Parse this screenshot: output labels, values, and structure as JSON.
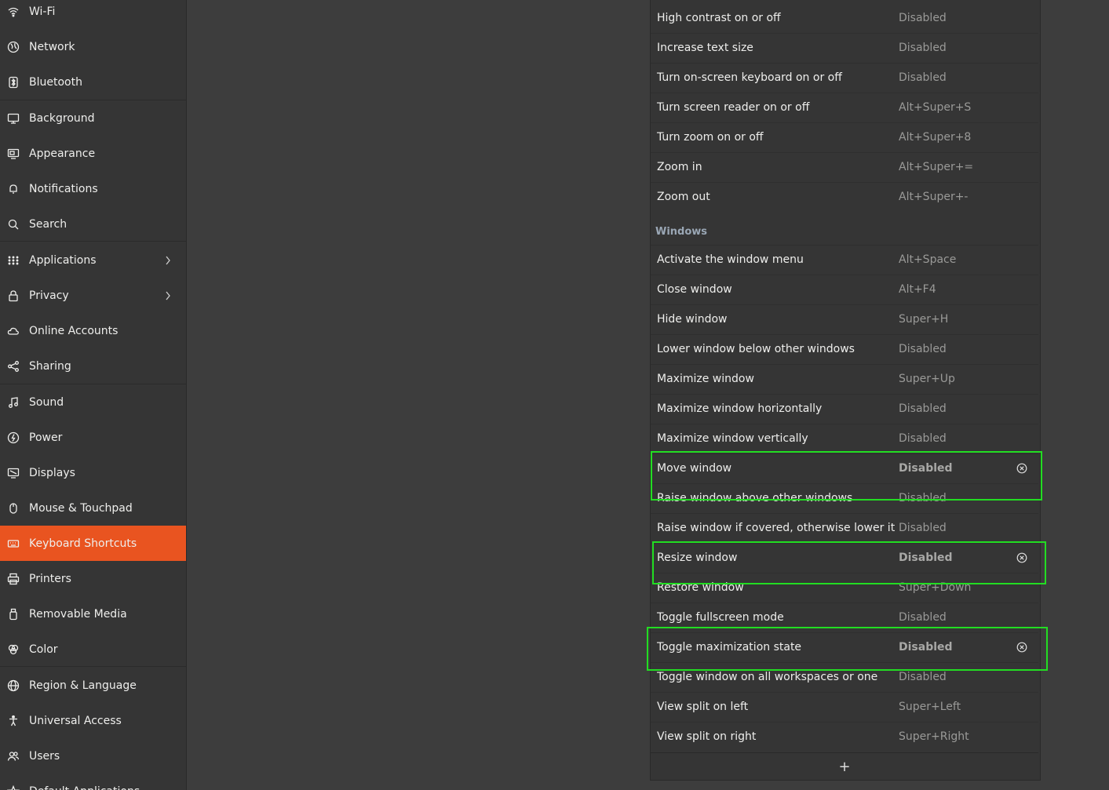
{
  "sidebar": {
    "items": [
      {
        "label": "Wi-Fi",
        "icon": "wifi-icon"
      },
      {
        "label": "Network",
        "icon": "network-icon"
      },
      {
        "label": "Bluetooth",
        "icon": "bluetooth-icon"
      },
      {
        "label": "Background",
        "icon": "background-icon"
      },
      {
        "label": "Appearance",
        "icon": "appearance-icon"
      },
      {
        "label": "Notifications",
        "icon": "bell-icon"
      },
      {
        "label": "Search",
        "icon": "search-icon"
      },
      {
        "label": "Applications",
        "icon": "apps-grid-icon",
        "chevron": true
      },
      {
        "label": "Privacy",
        "icon": "lock-icon",
        "chevron": true
      },
      {
        "label": "Online Accounts",
        "icon": "cloud-icon"
      },
      {
        "label": "Sharing",
        "icon": "share-icon"
      },
      {
        "label": "Sound",
        "icon": "music-note-icon"
      },
      {
        "label": "Power",
        "icon": "power-icon"
      },
      {
        "label": "Displays",
        "icon": "display-icon"
      },
      {
        "label": "Mouse & Touchpad",
        "icon": "mouse-icon"
      },
      {
        "label": "Keyboard Shortcuts",
        "icon": "keyboard-icon",
        "active": true
      },
      {
        "label": "Printers",
        "icon": "printer-icon"
      },
      {
        "label": "Removable Media",
        "icon": "usb-drive-icon"
      },
      {
        "label": "Color",
        "icon": "color-icon"
      },
      {
        "label": "Region & Language",
        "icon": "globe-icon"
      },
      {
        "label": "Universal Access",
        "icon": "accessibility-icon"
      },
      {
        "label": "Users",
        "icon": "users-icon"
      },
      {
        "label": "Default Applications",
        "icon": "star-icon"
      }
    ]
  },
  "accent_color": "#e95420",
  "highlight_color": "#22dd22",
  "shortcuts": {
    "top_rows": [
      {
        "name": "High contrast on or off",
        "accel": "Disabled"
      },
      {
        "name": "Increase text size",
        "accel": "Disabled"
      },
      {
        "name": "Turn on-screen keyboard on or off",
        "accel": "Disabled"
      },
      {
        "name": "Turn screen reader on or off",
        "accel": "Alt+Super+S"
      },
      {
        "name": "Turn zoom on or off",
        "accel": "Alt+Super+8"
      },
      {
        "name": "Zoom in",
        "accel": "Alt+Super+="
      },
      {
        "name": "Zoom out",
        "accel": "Alt+Super+-"
      }
    ],
    "windows_title": "Windows",
    "windows_rows": [
      {
        "name": "Activate the window menu",
        "accel": "Alt+Space"
      },
      {
        "name": "Close window",
        "accel": "Alt+F4"
      },
      {
        "name": "Hide window",
        "accel": "Super+H"
      },
      {
        "name": "Lower window below other windows",
        "accel": "Disabled"
      },
      {
        "name": "Maximize window",
        "accel": "Super+Up"
      },
      {
        "name": "Maximize window horizontally",
        "accel": "Disabled"
      },
      {
        "name": "Maximize window vertically",
        "accel": "Disabled"
      },
      {
        "name": "Move window",
        "accel": "Disabled",
        "modified": true
      },
      {
        "name": "Raise window above other windows",
        "accel": "Disabled"
      },
      {
        "name": "Raise window if covered, otherwise lower it",
        "accel": "Disabled"
      },
      {
        "name": "Resize window",
        "accel": "Disabled",
        "modified": true
      },
      {
        "name": "Restore window",
        "accel": "Super+Down"
      },
      {
        "name": "Toggle fullscreen mode",
        "accel": "Disabled"
      },
      {
        "name": "Toggle maximization state",
        "accel": "Disabled",
        "modified": true
      },
      {
        "name": "Toggle window on all workspaces or one",
        "accel": "Disabled"
      },
      {
        "name": "View split on left",
        "accel": "Super+Left"
      },
      {
        "name": "View split on right",
        "accel": "Super+Right"
      }
    ],
    "add_label": "+"
  }
}
